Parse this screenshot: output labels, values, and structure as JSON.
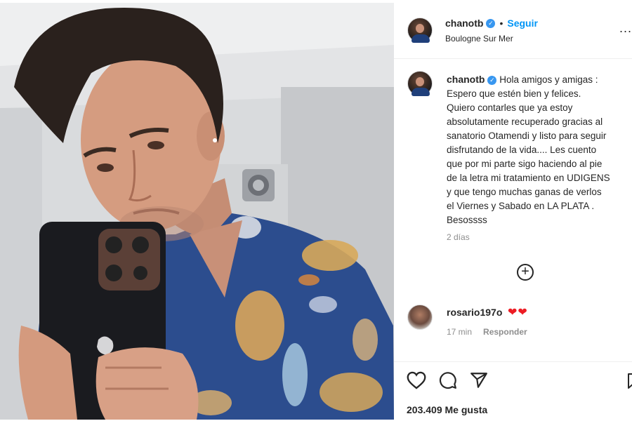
{
  "post": {
    "username": "chanotb",
    "follow_label": "Seguir",
    "separator": "•",
    "location": "Boulogne Sur Mer",
    "more_label": "..."
  },
  "caption": {
    "username": "chanotb",
    "lines": [
      "Hola amigos y amigas :",
      "Espero que estén bien y felices.",
      "Quiero contarles que ya estoy",
      "absolutamente recuperado gracias al",
      "sanatorio Otamendi y listo para seguir",
      "disfrutando de la vida.... Les cuento",
      "que por mi parte sigo haciendo al pie",
      "de la letra mi tratamiento en UDIGENS",
      "y que tengo muchas ganas de verlos",
      "el Viernes y Sabado en LA PLATA .",
      "Besossss"
    ],
    "time": "2 días"
  },
  "load_more_icon": "plus-circle-icon",
  "comment": {
    "username": "rosario197o",
    "text": "❤❤",
    "time": "17 min",
    "reply_label": "Responder"
  },
  "actions": {
    "icons": [
      "heart-icon",
      "comment-icon",
      "share-icon",
      "bookmark-icon"
    ]
  },
  "likes": "203.409 Me gusta",
  "colors": {
    "accent": "#0095f6",
    "verified": "#3897f0",
    "heart": "#ed1c24",
    "muted": "#8e8e8e"
  }
}
